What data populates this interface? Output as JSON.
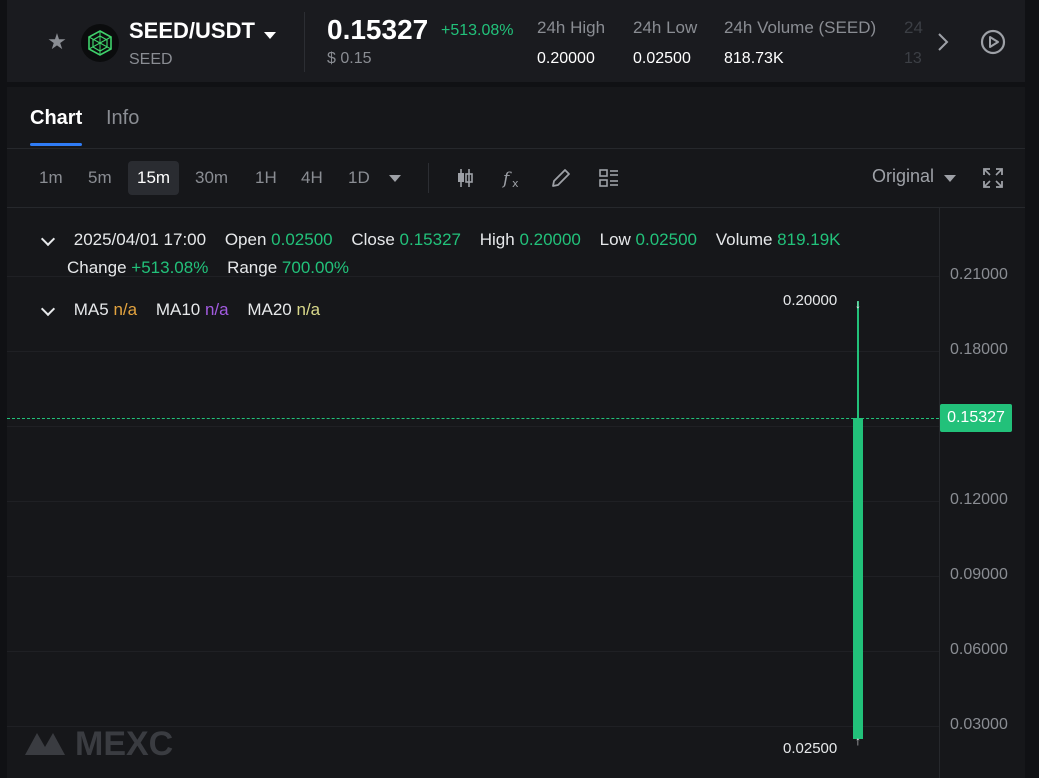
{
  "ticker": {
    "pair": "SEED/USDT",
    "base": "SEED",
    "last_price": "0.15327",
    "change_pct": "+513.08%",
    "usd_price": "$ 0.15",
    "stats": [
      {
        "label": "24h High",
        "value": "0.20000"
      },
      {
        "label": "24h Low",
        "value": "0.02500"
      },
      {
        "label": "24h Volume (SEED)",
        "value": "818.73K"
      }
    ],
    "stat_clipped": {
      "label": "24",
      "value": "13"
    }
  },
  "tabs": [
    "Chart",
    "Info"
  ],
  "intervals": [
    "1m",
    "5m",
    "15m",
    "30m",
    "1H",
    "4H",
    "1D"
  ],
  "active_interval": "15m",
  "price_mode": "Original",
  "ohlc": {
    "date": "2025/04/01 17:00",
    "open_label": "Open",
    "open": "0.02500",
    "close_label": "Close",
    "close": "0.15327",
    "high_label": "High",
    "high": "0.20000",
    "low_label": "Low",
    "low": "0.02500",
    "volume_label": "Volume",
    "volume": "819.19K",
    "change_label": "Change",
    "change": "+513.08%",
    "range_label": "Range",
    "range": "700.00%"
  },
  "ma": {
    "ma5_label": "MA5",
    "ma5": "n/a",
    "ma10_label": "MA10",
    "ma10": "n/a",
    "ma20_label": "MA20",
    "ma20": "n/a"
  },
  "axis_ticks": [
    "0.21000",
    "0.18000",
    "0.12000",
    "0.09000",
    "0.06000",
    "0.03000"
  ],
  "current_price_badge": "0.15327",
  "high_marker": "0.20000",
  "low_marker": "0.02500",
  "colors": {
    "up": "#22c17a",
    "accent": "#2f7cf6"
  },
  "chart_data": {
    "type": "candlestick",
    "interval": "15m",
    "candles": [
      {
        "time": "2025/04/01 17:00",
        "open": 0.025,
        "high": 0.2,
        "low": 0.025,
        "close": 0.15327
      }
    ],
    "y_ticks": [
      0.21,
      0.18,
      0.12,
      0.09,
      0.06,
      0.03
    ],
    "current_price": 0.15327,
    "ylim": [
      0.02,
      0.22
    ]
  }
}
